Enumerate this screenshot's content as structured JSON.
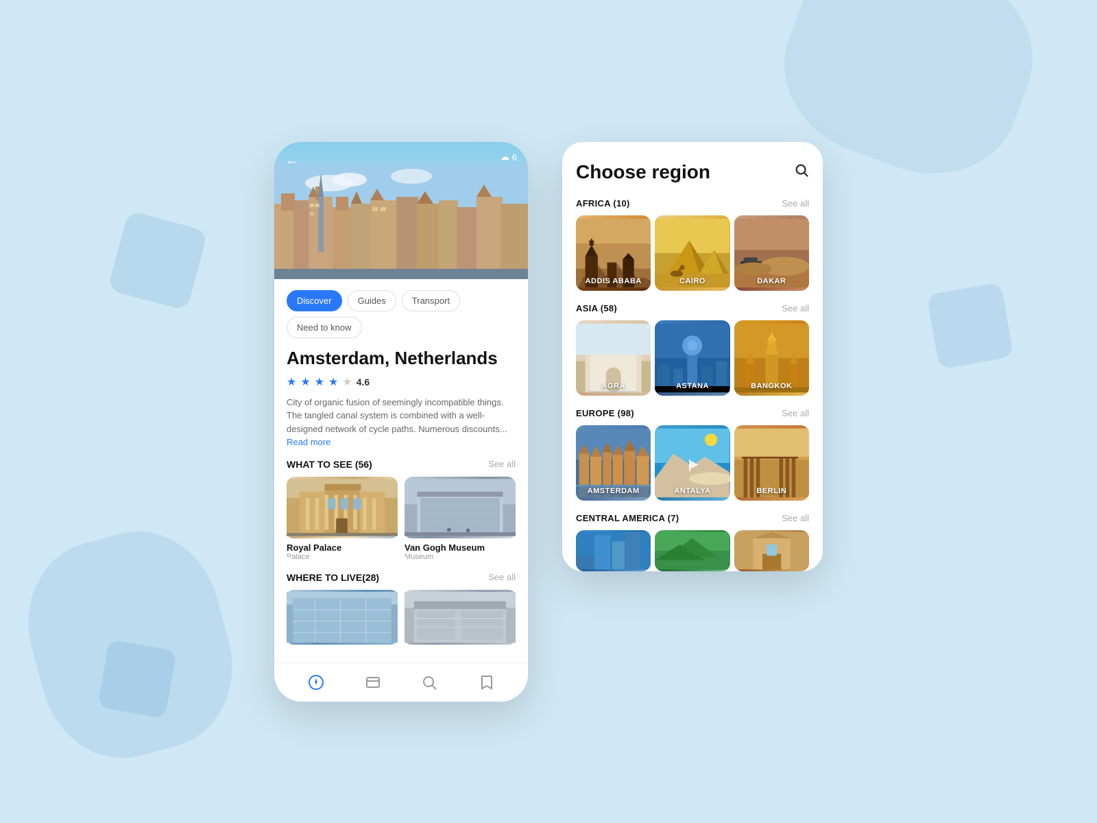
{
  "background": {
    "color": "#d0e8f5"
  },
  "screen1": {
    "city": "Amsterdam, Netherlands",
    "rating": "4.6",
    "description": "City of organic fusion of seemingly incompatible things. The tangled canal system is combined with a well-designed network of cycle paths. Numerous discounts...",
    "read_more": "Read more",
    "weather": "6",
    "tabs": [
      {
        "label": "Discover",
        "active": true
      },
      {
        "label": "Guides",
        "active": false
      },
      {
        "label": "Transport",
        "active": false
      },
      {
        "label": "Need to know",
        "active": false
      }
    ],
    "what_to_see": {
      "title": "WHAT TO SEE (56)",
      "see_all": "See all",
      "places": [
        {
          "name": "Royal Palace",
          "type": "Palace"
        },
        {
          "name": "Van Gogh Museum",
          "type": "Museum"
        }
      ]
    },
    "where_to_live": {
      "title": "WHERE TO LIVE(28)",
      "see_all": "See all"
    },
    "nav": {
      "items": [
        "compass",
        "cards",
        "search",
        "bookmark"
      ]
    }
  },
  "screen2": {
    "title": "Choose region",
    "sections": [
      {
        "title": "AFRICA (10)",
        "see_all": "See all",
        "items": [
          {
            "label": "ADDIS ABABA",
            "img_class": "img-addis"
          },
          {
            "label": "CAIRO",
            "img_class": "img-cairo"
          },
          {
            "label": "DAKAR",
            "img_class": "img-dakar"
          }
        ]
      },
      {
        "title": "ASIA (58)",
        "see_all": "See all",
        "items": [
          {
            "label": "AGRA",
            "img_class": "img-agra"
          },
          {
            "label": "ASTANA",
            "img_class": "img-astana"
          },
          {
            "label": "BANGKOK",
            "img_class": "img-bangkok"
          }
        ]
      },
      {
        "title": "EUROPE (98)",
        "see_all": "See all",
        "items": [
          {
            "label": "AMSTERDAM",
            "img_class": "img-amsterdam"
          },
          {
            "label": "ANTALYA",
            "img_class": "img-antalya"
          },
          {
            "label": "BERLIN",
            "img_class": "img-berlin"
          }
        ]
      },
      {
        "title": "CENTRAL AMERICA (7)",
        "see_all": "See all",
        "items": [
          {
            "label": "",
            "img_class": "img-central1"
          },
          {
            "label": "",
            "img_class": "img-central2"
          },
          {
            "label": "",
            "img_class": "img-central3"
          }
        ]
      }
    ]
  }
}
